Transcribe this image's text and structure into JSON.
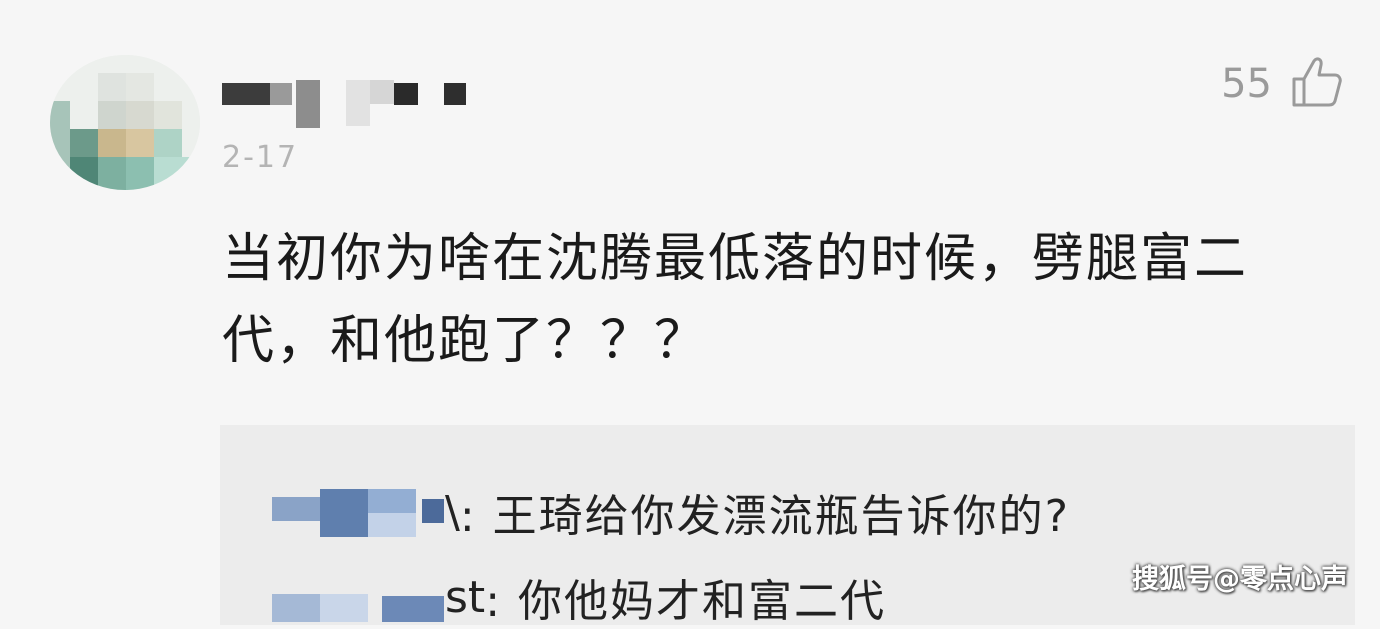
{
  "comment": {
    "timestamp": "2-17",
    "like_count": "55",
    "like_icon": "thumbs-up-icon",
    "text": "当初你为啥在沈腾最低落的时候，劈腿富二代，和他跑了？？？"
  },
  "replies": [
    {
      "name_suffix": "\\",
      "text": ": 王琦给你发漂流瓶告诉你的?"
    },
    {
      "name_suffix": "st",
      "text": ": 你他妈才和富二代"
    }
  ],
  "watermark": {
    "text": "搜狐号@零点心声"
  },
  "colors": {
    "background": "#f6f6f6",
    "reply_background": "#ececec",
    "meta_text": "#b4b4b4",
    "like_gray": "#9a9a9a"
  }
}
